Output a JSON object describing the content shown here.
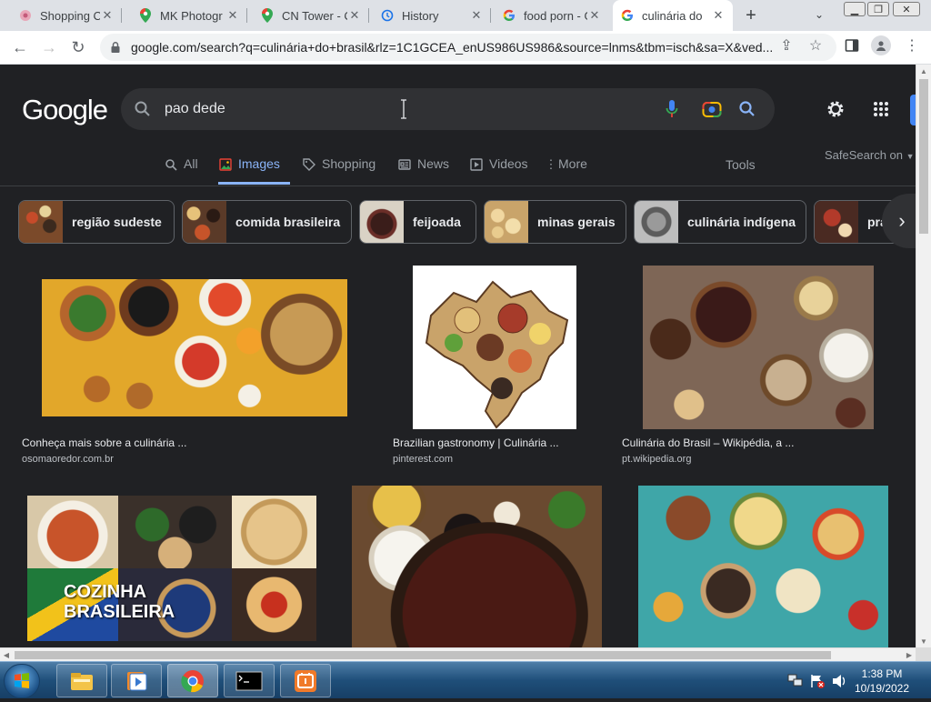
{
  "browser": {
    "tabs": [
      {
        "title": "Shopping Ca",
        "icon": "flower-icon"
      },
      {
        "title": "MK Photogr",
        "icon": "maps-pin-icon"
      },
      {
        "title": "CN Tower - C",
        "icon": "maps-pin-icon"
      },
      {
        "title": "History",
        "icon": "history-icon"
      },
      {
        "title": "food porn - G",
        "icon": "google-g-icon"
      },
      {
        "title": "culinária do",
        "icon": "google-g-icon",
        "active": true
      }
    ],
    "url": "google.com/search?q=culinária+do+brasil&rlz=1C1GCEA_enUS986US986&source=lnms&tbm=isch&sa=X&ved..."
  },
  "google": {
    "logo": "Google",
    "search_value": "pao dede",
    "nav_tabs": [
      {
        "label": "All",
        "icon": "search-icon"
      },
      {
        "label": "Images",
        "icon": "image-icon",
        "active": true
      },
      {
        "label": "Shopping",
        "icon": "tag-icon"
      },
      {
        "label": "News",
        "icon": "news-icon"
      },
      {
        "label": "Videos",
        "icon": "play-icon"
      },
      {
        "label": "More",
        "icon": "more-vert-icon"
      }
    ],
    "tools": "Tools",
    "safesearch": "SafeSearch on",
    "chips": [
      {
        "label": "região sudeste"
      },
      {
        "label": "comida brasileira"
      },
      {
        "label": "feijoada"
      },
      {
        "label": "minas gerais"
      },
      {
        "label": "culinária indígena"
      },
      {
        "label": "pra"
      }
    ],
    "results": [
      {
        "title": "Conheça mais sobre a culinária ...",
        "source": "osomaoredor.com.br"
      },
      {
        "title": "Brazilian gastronomy | Culinária ...",
        "source": "pinterest.com"
      },
      {
        "title": "Culinária do Brasil – Wikipédia, a ...",
        "source": "pt.wikipedia.org"
      },
      {
        "title": "",
        "source": "",
        "overlay": "COZINHA BRASILEIRA"
      },
      {
        "title": "",
        "source": ""
      },
      {
        "title": "",
        "source": ""
      }
    ]
  },
  "taskbar": {
    "apps": [
      "explorer-icon",
      "media-player-icon",
      "chrome-icon",
      "terminal-icon",
      "app-icon"
    ],
    "time": "1:38 PM",
    "date": "10/19/2022"
  },
  "colors": {
    "page_bg": "#202124",
    "accent_blue": "#8ab4f8",
    "search_bg": "#303134"
  }
}
